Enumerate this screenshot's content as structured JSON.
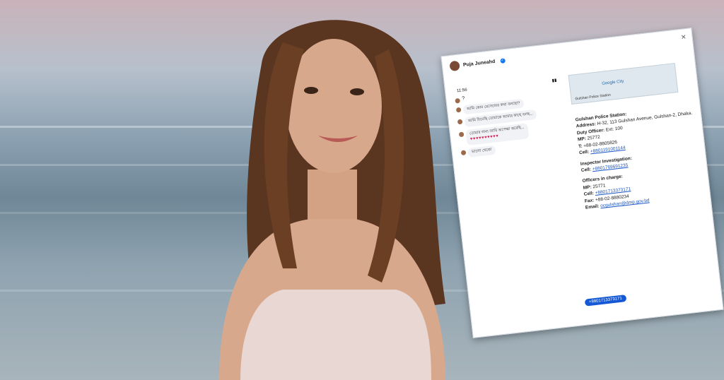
{
  "post": {
    "author": "Puja Juneahd",
    "time_short": "11:56"
  },
  "chat": {
    "header_name": "?",
    "messages": [
      {
        "text": "আমি কোন মেসেজের কথা বলছো?"
      },
      {
        "text": "আমি চিনেছি তোমাকে আমার কাছে বলছ..."
      },
      {
        "text": "তোমার জন্য আমি অপেক্ষা করেছি..."
      },
      {
        "text": "ভালো থেকো"
      }
    ],
    "hearts": "♥♥♥♥♥♥♥♥♥♥",
    "phone_pill": "+8801713373171"
  },
  "station": {
    "map_label": "Google City",
    "map_label2": "Gulshan Police Station",
    "title": "Gulshan Police Station:",
    "address_label": "Address:",
    "address": "H-32, 113 Gulshan Avenue, Gulshan-2, Dhaka.",
    "duty_officer_label": "Duty Officer:",
    "duty_officer": "Ext: 100",
    "mp_label": "MP:",
    "mp": "25772",
    "t_label": "T:",
    "t": "+88-02-8805826",
    "cell_label": "Cell:",
    "cell": "+8801191001144",
    "inspector_title": "Inspector Investigation:",
    "inspector_cell_label": "Cell:",
    "inspector_cell": "+8801769691235",
    "officers_title": "Officers in charge:",
    "officers_mp_label": "MP:",
    "officers_mp": "25771",
    "officers_cell_label": "Cell:",
    "officers_cell": "+8801713373171",
    "officers_fax_label": "Fax:",
    "officers_fax": "+88-02-8880234",
    "email_label": "Email:",
    "email": "ocgulshan@dmp.gov.bd"
  }
}
